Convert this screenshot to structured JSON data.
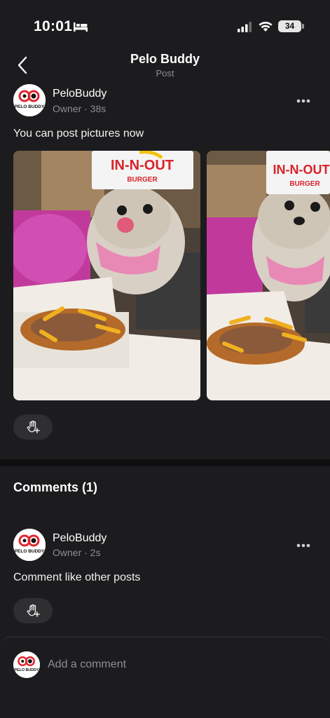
{
  "status_bar": {
    "time": "10:01",
    "battery": "34"
  },
  "header": {
    "title": "Pelo Buddy",
    "subtitle": "Post"
  },
  "post": {
    "author": "PeloBuddy",
    "role": "Owner",
    "age": "38s",
    "meta": "Owner · 38s",
    "text": "You can post pictures now",
    "images": [
      {
        "sign_text": "IN-N-OUT",
        "sign_subtext": "BURGER"
      },
      {
        "sign_text": "IN-N-OUT",
        "sign_subtext": "BURGER"
      }
    ]
  },
  "comments": {
    "heading": "Comments (1)",
    "items": [
      {
        "author": "PeloBuddy",
        "meta": "Owner · 2s",
        "text": "Comment like other posts"
      }
    ]
  },
  "composer": {
    "placeholder": "Add a comment"
  },
  "avatar": {
    "logo_text": "PELO BUDDY"
  },
  "colors": {
    "background": "#1c1c1e",
    "divider": "#0f0f10",
    "muted": "#8e8e93",
    "chip": "#2f2f31",
    "logo_red": "#e0262f"
  },
  "icons": [
    "back-chevron-icon",
    "bed-icon",
    "signal-icon",
    "wifi-icon",
    "more-icon",
    "add-reaction-icon"
  ]
}
